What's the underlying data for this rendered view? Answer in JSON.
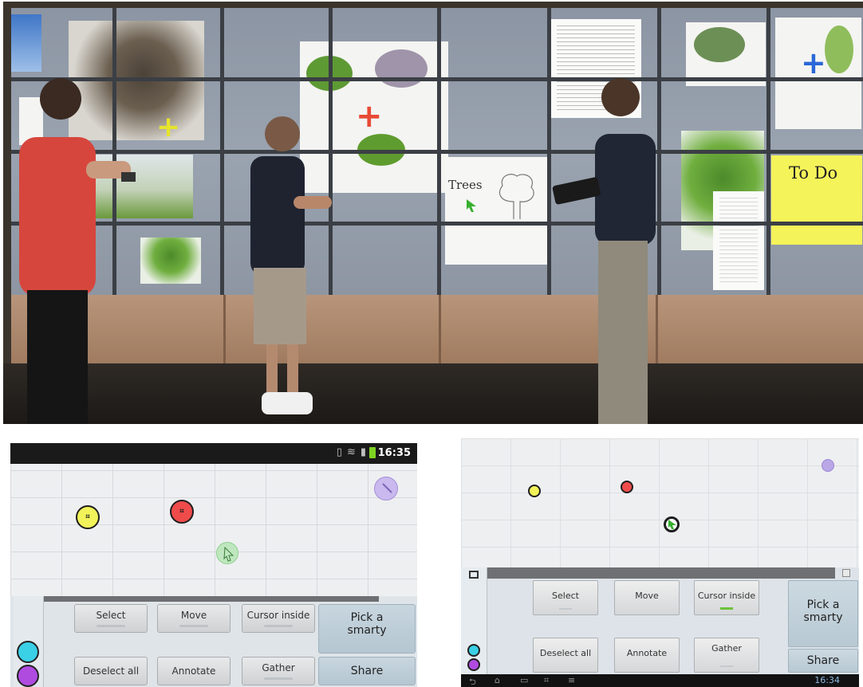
{
  "photo": {
    "trees_label": "Trees",
    "todo_title": "To Do"
  },
  "phone": {
    "status": {
      "time": "16:35"
    },
    "buttons": {
      "select": "Select",
      "move": "Move",
      "cursor_inside": "Cursor inside",
      "pick_smarty": "Pick a smarty",
      "deselect_all": "Deselect all",
      "annotate": "Annotate",
      "gather": "Gather",
      "share": "Share"
    }
  },
  "tablet": {
    "buttons": {
      "select": "Select",
      "move": "Move",
      "cursor_inside": "Cursor inside",
      "pick_smarty": "Pick a smarty",
      "deselect_all": "Deselect all",
      "annotate": "Annotate",
      "gather": "Gather",
      "share": "Share"
    },
    "nav": {
      "time": "16:34"
    }
  },
  "colors": {
    "smarty_yellow": "#f2f25a",
    "smarty_red": "#ef4b4b",
    "smarty_cyan": "#3ad0e6",
    "smarty_purple": "#b04be0",
    "smarty_lavender": "#b9a7e6",
    "cursor_green": "#37b02f",
    "todo_yellow": "#f5f35a"
  },
  "icons": {
    "phone_status": [
      "vibrate-icon",
      "wifi-icon",
      "signal-icon",
      "battery-icon"
    ],
    "tablet_nav": [
      "back-icon",
      "home-icon",
      "recent-apps-icon",
      "screenshot-icon",
      "menu-icon"
    ]
  }
}
